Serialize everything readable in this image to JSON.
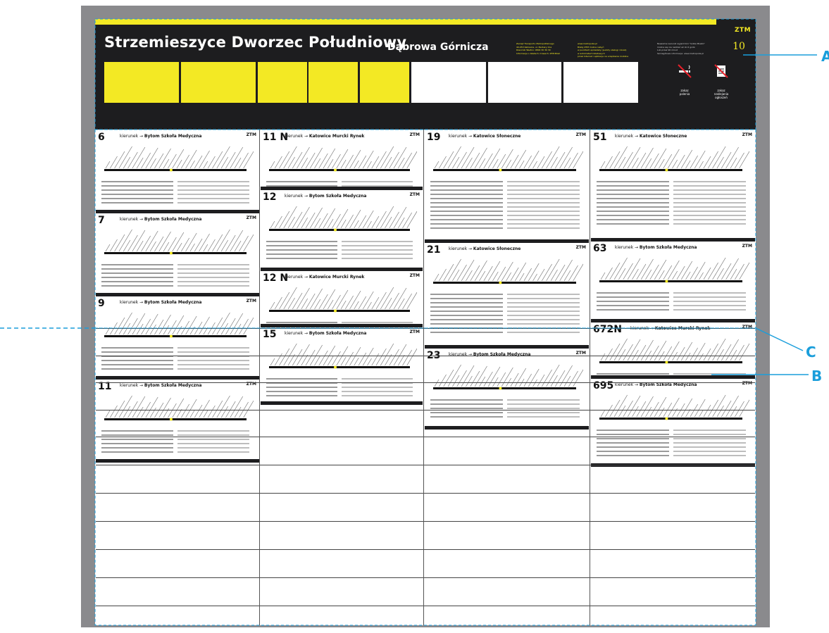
{
  "header": {
    "stop_name": "Strzemieszyce Dworzec Południowy",
    "city": "Dąbrowa Górnicza",
    "logo": "ZTM",
    "board_number": "10",
    "info_col1": [
      "Zarząd Transportu Metropolitalnego",
      "40-053 Katowice, ul. Barbary 21a",
      "Rzecznik Telefon: 0800 30 30 30",
      "Informacje o biletach i trasach: ZTM.Bilet"
    ],
    "info_col2": [
      "www.metropolia.pl",
      "Bilety ZTM można nabyć:",
      "w punktach sprzedaży (punkty obsługi i kiosk)",
      "w automatach biletowych",
      "przez Internet i aplikacje na urządzenia mobilne"
    ],
    "info_col3": [
      "Nieważne warunki wyjazd linii \"Gdzie Miasto\"",
      "można się nie nadziać aż do 6 godz.",
      "Lub przez 90 minut",
      "Szczegółowe informacje: www.metropolia.pl"
    ],
    "ban_smoking_icon": "no-smoking-icon",
    "ban_smoking_label": [
      "zakaz",
      "palenia"
    ],
    "ban_posters_icon": "no-posters-icon",
    "ban_posters_label": [
      "zakaz",
      "naklejania",
      "ogłoszeń"
    ],
    "accent_color": "#f3e924"
  },
  "timetables": {
    "c1": [
      {
        "line": "6",
        "direction": "Bytom Szkoła Medyczna"
      },
      {
        "line": "7",
        "direction": "Bytom Szkoła Medyczna"
      },
      {
        "line": "9",
        "direction": "Bytom Szkoła Medyczna"
      },
      {
        "line": "11",
        "direction": "Bytom Szkoła Medyczna"
      }
    ],
    "c2": [
      {
        "line": "11 N",
        "direction": "Katowice Murcki Rynek"
      },
      {
        "line": "12",
        "direction": "Bytom Szkoła Medyczna"
      },
      {
        "line": "12 N",
        "direction": "Katowice Murcki Rynek"
      },
      {
        "line": "15",
        "direction": "Bytom Szkoła Medyczna"
      }
    ],
    "c3": [
      {
        "line": "19",
        "direction": "Katowice Słoneczne"
      },
      {
        "line": "21",
        "direction": "Katowice Słoneczne"
      },
      {
        "line": "23",
        "direction": "Bytom Szkoła Medyczna"
      }
    ],
    "c4": [
      {
        "line": "51",
        "direction": "Katowice Słoneczne"
      },
      {
        "line": "63",
        "direction": "Bytom Szkoła Medyczna"
      },
      {
        "line": "672N",
        "direction": "Katowice Murcki Rynek"
      },
      {
        "line": "695",
        "direction": "Bytom Szkoła Medyczna"
      }
    ],
    "direction_prefix": "kierunek",
    "logo": "ZTM"
  },
  "labels": {
    "a": "A",
    "b": "B",
    "c": "C"
  },
  "colors": {
    "guide": "#1a9edb",
    "yellow": "#f3e924",
    "dark": "#1d1d1f",
    "board": "#8a8a8d"
  }
}
